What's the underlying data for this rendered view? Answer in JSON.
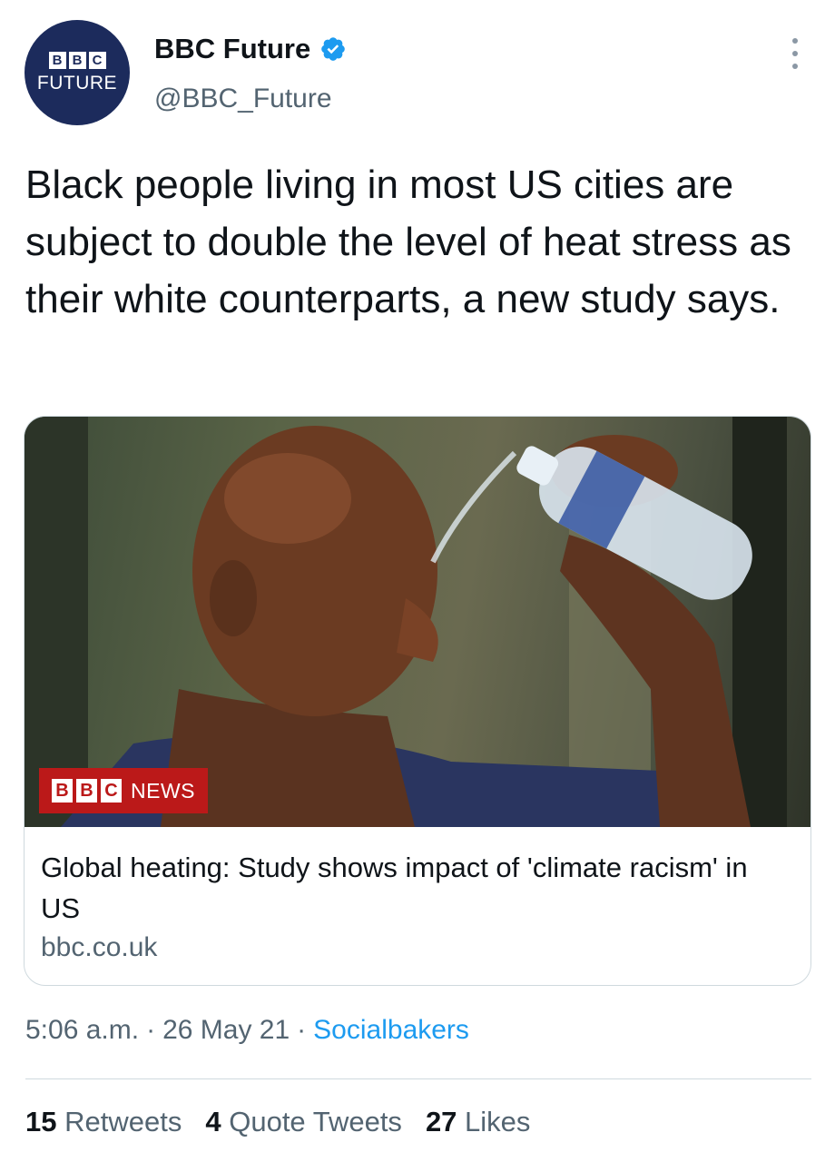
{
  "account": {
    "avatar_blocks": [
      "B",
      "B",
      "C"
    ],
    "avatar_word": "FUTURE",
    "display_name": "BBC Future",
    "handle": "@BBC_Future",
    "verified": true,
    "brand_color": "#1c2b5c"
  },
  "tweet": {
    "text": "Black people living in most US cities are subject to double the level of heat stress as their white counterparts, a new study says."
  },
  "card": {
    "image_badge_blocks": [
      "B",
      "B",
      "C"
    ],
    "image_badge_word": "NEWS",
    "badge_color": "#bb1919",
    "title": "Global heating: Study shows impact of 'climate racism' in US",
    "domain": "bbc.co.uk"
  },
  "meta": {
    "time": "5:06 a.m.",
    "date": "26 May 21",
    "source": "Socialbakers",
    "separator": "·"
  },
  "stats": {
    "retweets_count": "15",
    "retweets_label": "Retweets",
    "quotes_count": "4",
    "quotes_label": "Quote Tweets",
    "likes_count": "27",
    "likes_label": "Likes"
  },
  "icons": {
    "verified": "verified-badge-icon",
    "more": "more-options-icon"
  },
  "colors": {
    "link": "#1d9bf0",
    "secondary_text": "#536471",
    "verified": "#1d9bf0"
  }
}
